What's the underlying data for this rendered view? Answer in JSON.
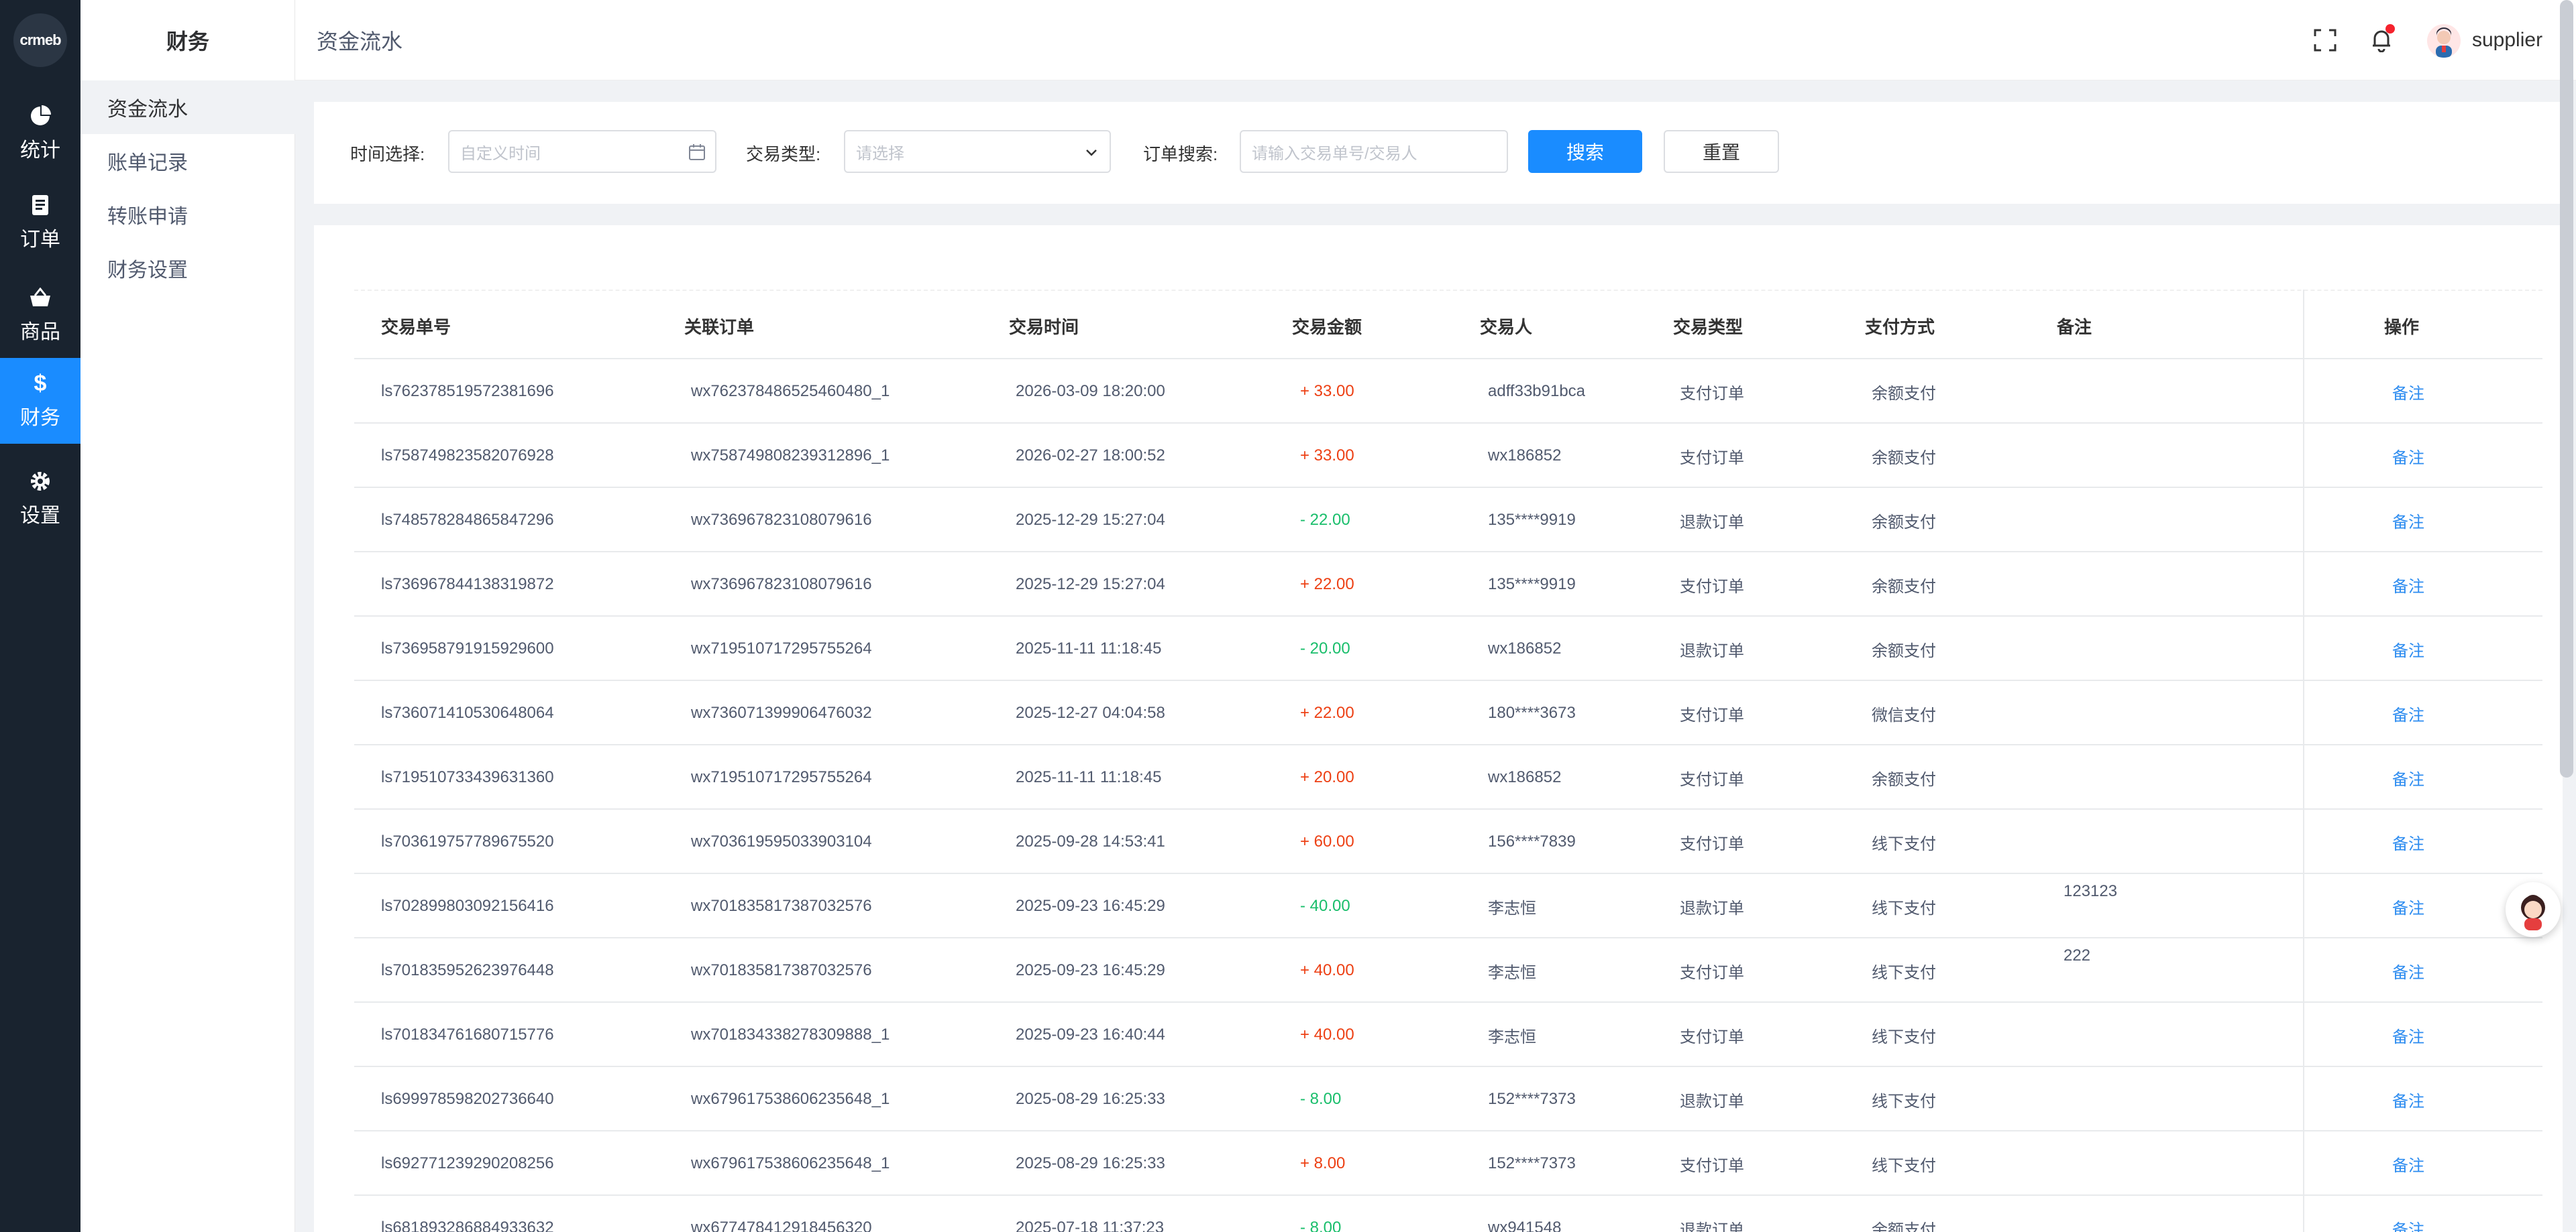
{
  "logo_text": "crmeb",
  "rail": [
    {
      "label": "统计",
      "icon": "pie-chart-icon"
    },
    {
      "label": "订单",
      "icon": "document-icon"
    },
    {
      "label": "商品",
      "icon": "basket-icon"
    },
    {
      "label": "财务",
      "icon": "dollar-icon",
      "active": true
    },
    {
      "label": "设置",
      "icon": "gear-icon"
    }
  ],
  "submenu": {
    "title": "财务",
    "items": [
      "资金流水",
      "账单记录",
      "转账申请",
      "财务设置"
    ]
  },
  "header": {
    "breadcrumb": "资金流水",
    "username": "supplier"
  },
  "search": {
    "time_label": "时间选择:",
    "time_placeholder": "自定义时间",
    "type_label": "交易类型:",
    "type_placeholder": "请选择",
    "order_label": "订单搜索:",
    "order_placeholder": "请输入交易单号/交易人",
    "search_btn": "搜索",
    "reset_btn": "重置"
  },
  "table": {
    "headers": [
      "交易单号",
      "关联订单",
      "交易时间",
      "交易金额",
      "交易人",
      "交易类型",
      "支付方式",
      "备注",
      "操作"
    ],
    "rows": [
      {
        "no": "ls762378519572381696",
        "order": "wx762378486525460480_1",
        "time": "2026-03-09 18:20:00",
        "amount": "+ 33.00",
        "sign": "pos",
        "user": "adff33b91bca",
        "type": "支付订单",
        "pay": "余额支付",
        "remark": "",
        "op": "备注"
      },
      {
        "no": "ls758749823582076928",
        "order": "wx758749808239312896_1",
        "time": "2026-02-27 18:00:52",
        "amount": "+ 33.00",
        "sign": "pos",
        "user": "wx186852",
        "type": "支付订单",
        "pay": "余额支付",
        "remark": "",
        "op": "备注"
      },
      {
        "no": "ls748578284865847296",
        "order": "wx736967823108079616",
        "time": "2025-12-29 15:27:04",
        "amount": "- 22.00",
        "sign": "neg",
        "user": "135****9919",
        "type": "退款订单",
        "pay": "余额支付",
        "remark": "",
        "op": "备注"
      },
      {
        "no": "ls736967844138319872",
        "order": "wx736967823108079616",
        "time": "2025-12-29 15:27:04",
        "amount": "+ 22.00",
        "sign": "pos",
        "user": "135****9919",
        "type": "支付订单",
        "pay": "余额支付",
        "remark": "",
        "op": "备注"
      },
      {
        "no": "ls736958791915929600",
        "order": "wx719510717295755264",
        "time": "2025-11-11 11:18:45",
        "amount": "- 20.00",
        "sign": "neg",
        "user": "wx186852",
        "type": "退款订单",
        "pay": "余额支付",
        "remark": "",
        "op": "备注"
      },
      {
        "no": "ls736071410530648064",
        "order": "wx736071399906476032",
        "time": "2025-12-27 04:04:58",
        "amount": "+ 22.00",
        "sign": "pos",
        "user": "180****3673",
        "type": "支付订单",
        "pay": "微信支付",
        "remark": "",
        "op": "备注"
      },
      {
        "no": "ls719510733439631360",
        "order": "wx719510717295755264",
        "time": "2025-11-11 11:18:45",
        "amount": "+ 20.00",
        "sign": "pos",
        "user": "wx186852",
        "type": "支付订单",
        "pay": "余额支付",
        "remark": "",
        "op": "备注"
      },
      {
        "no": "ls703619757789675520",
        "order": "wx703619595033903104",
        "time": "2025-09-28 14:53:41",
        "amount": "+ 60.00",
        "sign": "pos",
        "user": "156****7839",
        "type": "支付订单",
        "pay": "线下支付",
        "remark": "",
        "op": "备注"
      },
      {
        "no": "ls702899803092156416",
        "order": "wx701835817387032576",
        "time": "2025-09-23 16:45:29",
        "amount": "- 40.00",
        "sign": "neg",
        "user": "李志恒",
        "type": "退款订单",
        "pay": "线下支付",
        "remark": "123123",
        "op": "备注"
      },
      {
        "no": "ls701835952623976448",
        "order": "wx701835817387032576",
        "time": "2025-09-23 16:45:29",
        "amount": "+ 40.00",
        "sign": "pos",
        "user": "李志恒",
        "type": "支付订单",
        "pay": "线下支付",
        "remark": "222",
        "op": "备注"
      },
      {
        "no": "ls701834761680715776",
        "order": "wx701834338278309888_1",
        "time": "2025-09-23 16:40:44",
        "amount": "+ 40.00",
        "sign": "pos",
        "user": "李志恒",
        "type": "支付订单",
        "pay": "线下支付",
        "remark": "",
        "op": "备注"
      },
      {
        "no": "ls699978598202736640",
        "order": "wx679617538606235648_1",
        "time": "2025-08-29 16:25:33",
        "amount": "- 8.00",
        "sign": "neg",
        "user": "152****7373",
        "type": "退款订单",
        "pay": "线下支付",
        "remark": "",
        "op": "备注"
      },
      {
        "no": "ls692771239290208256",
        "order": "wx679617538606235648_1",
        "time": "2025-08-29 16:25:33",
        "amount": "+ 8.00",
        "sign": "pos",
        "user": "152****7373",
        "type": "支付订单",
        "pay": "线下支付",
        "remark": "",
        "op": "备注"
      },
      {
        "no": "ls681893286884933632",
        "order": "wx677478412918456320",
        "time": "2025-07-18 11:37:23",
        "amount": "- 8.00",
        "sign": "neg",
        "user": "wx941548",
        "type": "退款订单",
        "pay": "余额支付",
        "remark": "",
        "op": "备注"
      }
    ]
  },
  "colors": {
    "accent": "#1a8cff",
    "rail_bg": "#19232f",
    "positive": "#ed4014",
    "negative": "#19be6b",
    "link": "#2d8cf0"
  }
}
